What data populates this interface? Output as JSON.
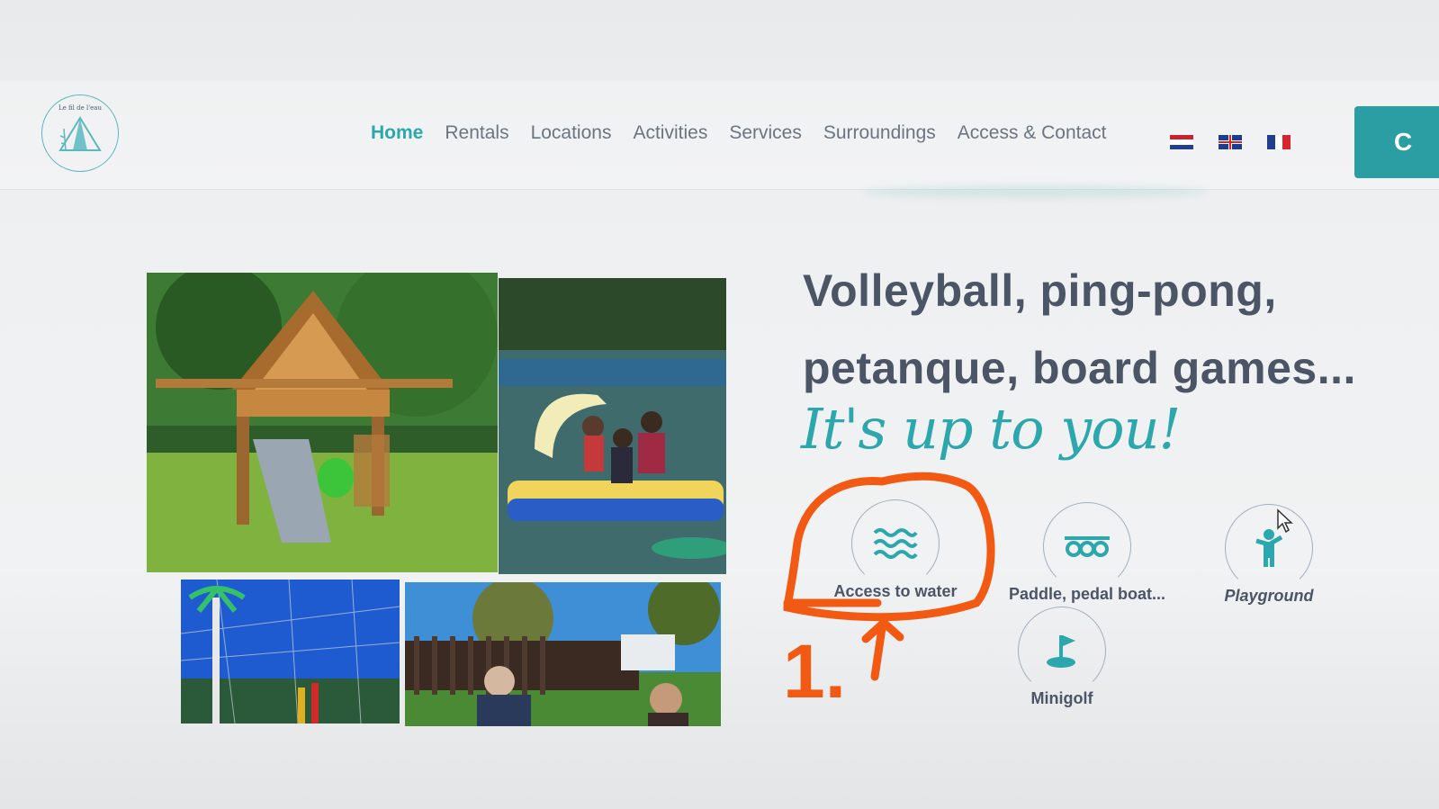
{
  "header": {
    "logo_text": "Le fil de l'eau",
    "nav": [
      "Home",
      "Rentals",
      "Locations",
      "Activities",
      "Services",
      "Surroundings",
      "Access & Contact"
    ],
    "active_nav": "Home",
    "languages": [
      "nl",
      "en",
      "fr"
    ],
    "cta_label": "C"
  },
  "hero": {
    "heading_line1": "Volleyball, ping-pong,",
    "heading_line2": "petanque, board games...",
    "tagline": "It's up to you!"
  },
  "activities": [
    {
      "label": "Access to water",
      "icon": "water-waves-icon"
    },
    {
      "label": "Paddle, pedal boat...",
      "icon": "paddle-boat-icon"
    },
    {
      "label": "Playground",
      "icon": "playground-child-icon"
    },
    {
      "label": "Minigolf",
      "icon": "minigolf-flag-icon"
    }
  ],
  "annotation": {
    "text": "1.",
    "color": "#f25a14"
  },
  "colors": {
    "accent": "#2ba7ad",
    "text": "#4b5566",
    "nav": "#6a7582"
  }
}
